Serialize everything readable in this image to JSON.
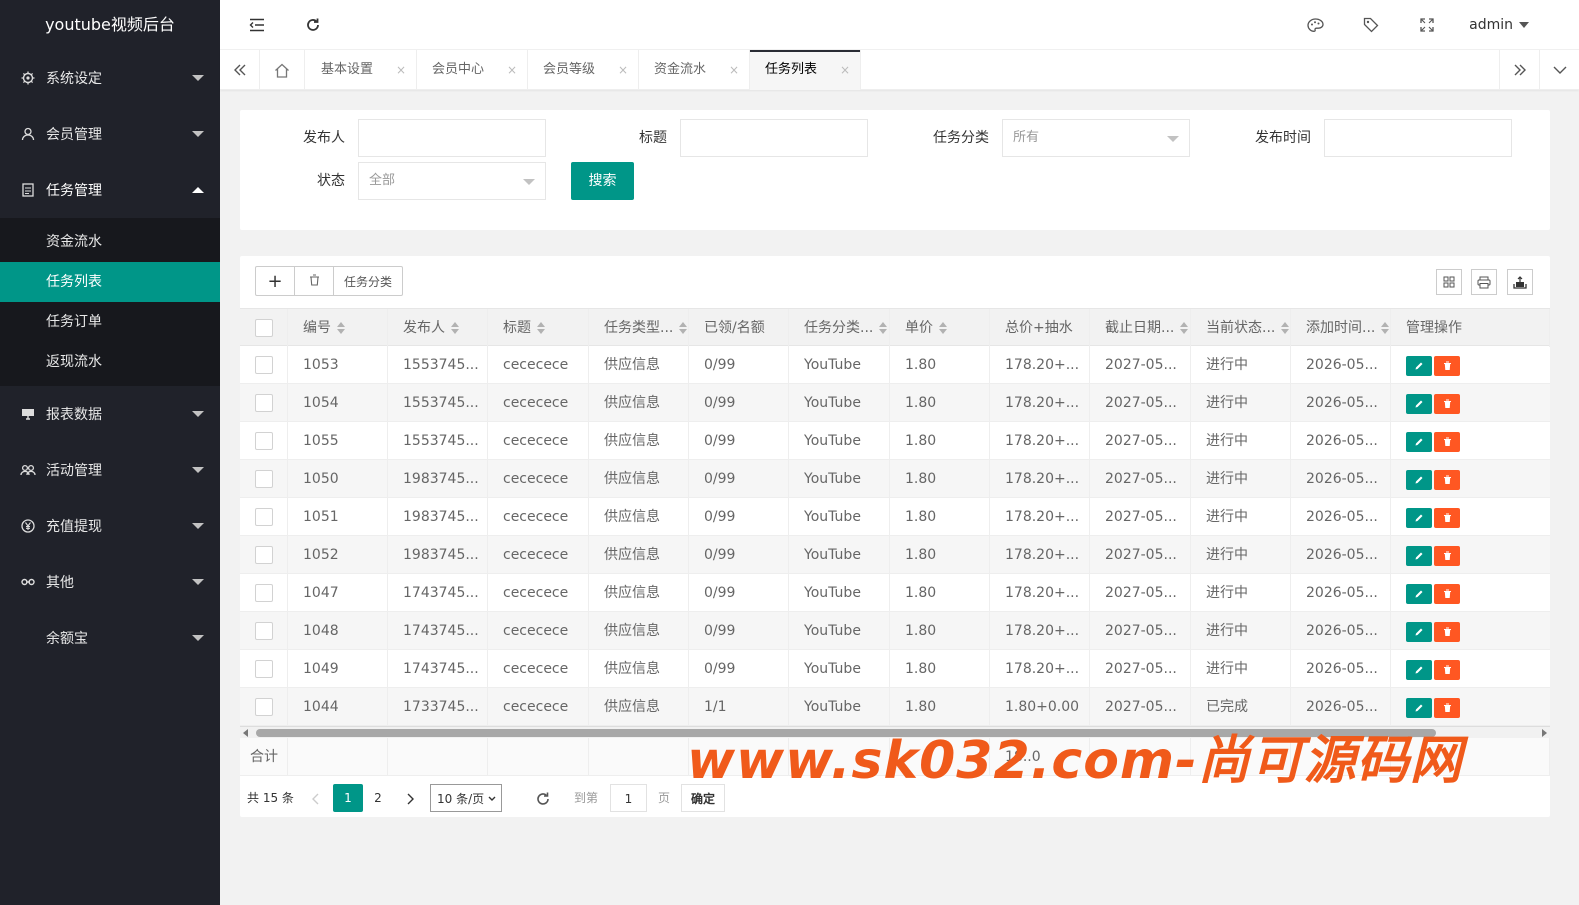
{
  "app": {
    "title": "youtube视频后台"
  },
  "sidebar": {
    "items": [
      {
        "label": "系统设定",
        "icon": "gear-icon",
        "open": false
      },
      {
        "label": "会员管理",
        "icon": "user-icon",
        "open": false
      },
      {
        "label": "任务管理",
        "icon": "document-icon",
        "open": true
      },
      {
        "label": "报表数据",
        "icon": "monitor-icon",
        "open": false
      },
      {
        "label": "活动管理",
        "icon": "group-icon",
        "open": false
      },
      {
        "label": "充值提现",
        "icon": "circle-icon",
        "open": false
      },
      {
        "label": "其他",
        "icon": "link-icon",
        "open": false
      },
      {
        "label": "余额宝",
        "icon": "",
        "open": false
      }
    ],
    "subitems": [
      {
        "label": "资金流水",
        "active": false
      },
      {
        "label": "任务列表",
        "active": true
      },
      {
        "label": "任务订单",
        "active": false
      },
      {
        "label": "返现流水",
        "active": false
      }
    ]
  },
  "header": {
    "user": "admin"
  },
  "tabs": [
    {
      "label": "基本设置",
      "close": "×"
    },
    {
      "label": "会员中心",
      "close": "×"
    },
    {
      "label": "会员等级",
      "close": "×"
    },
    {
      "label": "资金流水",
      "close": "×"
    },
    {
      "label": "任务列表",
      "close": "×",
      "active": true
    }
  ],
  "search": {
    "publisher_label": "发布人",
    "title_label": "标题",
    "category_label": "任务分类",
    "category_value": "所有",
    "time_label": "发布时间",
    "status_label": "状态",
    "status_value": "全部",
    "button": "搜索"
  },
  "toolbar": {
    "add": "+",
    "category": "任务分类"
  },
  "table": {
    "columns": [
      "编号",
      "发布人",
      "标题",
      "任务类型...",
      "已领/名额",
      "任务分类...",
      "单价",
      "总价+抽水",
      "截止日期...",
      "当前状态...",
      "添加时间...",
      "管理操作"
    ],
    "rows": [
      [
        "1053",
        "1553745...",
        "cececece",
        "供应信息",
        "0/99",
        "YouTube",
        "1.80",
        "178.20+...",
        "2027-05...",
        "进行中",
        "2026-05..."
      ],
      [
        "1054",
        "1553745...",
        "cececece",
        "供应信息",
        "0/99",
        "YouTube",
        "1.80",
        "178.20+...",
        "2027-05...",
        "进行中",
        "2026-05..."
      ],
      [
        "1055",
        "1553745...",
        "cececece",
        "供应信息",
        "0/99",
        "YouTube",
        "1.80",
        "178.20+...",
        "2027-05...",
        "进行中",
        "2026-05..."
      ],
      [
        "1050",
        "1983745...",
        "cececece",
        "供应信息",
        "0/99",
        "YouTube",
        "1.80",
        "178.20+...",
        "2027-05...",
        "进行中",
        "2026-05..."
      ],
      [
        "1051",
        "1983745...",
        "cececece",
        "供应信息",
        "0/99",
        "YouTube",
        "1.80",
        "178.20+...",
        "2027-05...",
        "进行中",
        "2026-05..."
      ],
      [
        "1052",
        "1983745...",
        "cececece",
        "供应信息",
        "0/99",
        "YouTube",
        "1.80",
        "178.20+...",
        "2027-05...",
        "进行中",
        "2026-05..."
      ],
      [
        "1047",
        "1743745...",
        "cececece",
        "供应信息",
        "0/99",
        "YouTube",
        "1.80",
        "178.20+...",
        "2027-05...",
        "进行中",
        "2026-05..."
      ],
      [
        "1048",
        "1743745...",
        "cececece",
        "供应信息",
        "0/99",
        "YouTube",
        "1.80",
        "178.20+...",
        "2027-05...",
        "进行中",
        "2026-05..."
      ],
      [
        "1049",
        "1743745...",
        "cececece",
        "供应信息",
        "0/99",
        "YouTube",
        "1.80",
        "178.20+...",
        "2027-05...",
        "进行中",
        "2026-05..."
      ],
      [
        "1044",
        "1733745...",
        "cececece",
        "供应信息",
        "1/1",
        "YouTube",
        "1.80",
        "1.80+0.00",
        "2027-05...",
        "已完成",
        "2026-05..."
      ]
    ],
    "total_label": "合计",
    "total_value": "18..0"
  },
  "pager": {
    "total": "共 15 条",
    "pages": [
      "1",
      "2"
    ],
    "current": "1",
    "page_size": "10 条/页",
    "goto_label": "到第",
    "goto_value": "1",
    "page_unit": "页",
    "confirm": "确定"
  },
  "watermark": "www.sk032.com-尚可源码网",
  "colors": {
    "accent": "#009688",
    "danger": "#ff5722",
    "sidebar": "#20222a"
  }
}
